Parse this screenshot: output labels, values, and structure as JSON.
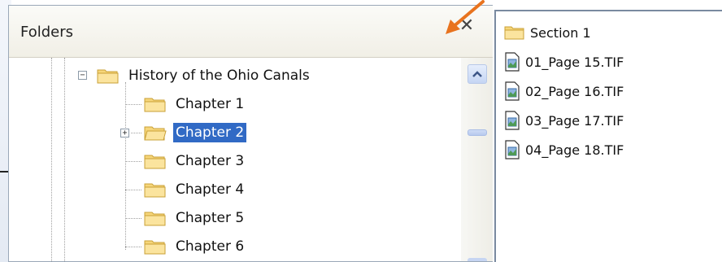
{
  "pane": {
    "title": "Folders",
    "close_glyph": "✕"
  },
  "tree": {
    "root": {
      "label": "History of the Ohio Canals",
      "expanded": true,
      "expander": "−"
    },
    "children": [
      {
        "label": "Chapter 1",
        "selected": false,
        "expander": ""
      },
      {
        "label": "Chapter 2",
        "selected": true,
        "expander": "+"
      },
      {
        "label": "Chapter 3",
        "selected": false,
        "expander": ""
      },
      {
        "label": "Chapter 4",
        "selected": false,
        "expander": ""
      },
      {
        "label": "Chapter 5",
        "selected": false,
        "expander": ""
      },
      {
        "label": "Chapter 6",
        "selected": false,
        "expander": ""
      }
    ]
  },
  "files": {
    "folder": {
      "label": "Section 1",
      "icon": "folder-icon"
    },
    "items": [
      {
        "label": "01_Page 15.TIF",
        "icon": "tif-file-icon"
      },
      {
        "label": "02_Page 16.TIF",
        "icon": "tif-file-icon"
      },
      {
        "label": "03_Page 17.TIF",
        "icon": "tif-file-icon"
      },
      {
        "label": "04_Page 18.TIF",
        "icon": "tif-file-icon"
      }
    ]
  },
  "colors": {
    "selection": "#316ac5",
    "arrow": "#e8731e",
    "folder_fill": "#f6d67a",
    "folder_stroke": "#c9a037"
  }
}
